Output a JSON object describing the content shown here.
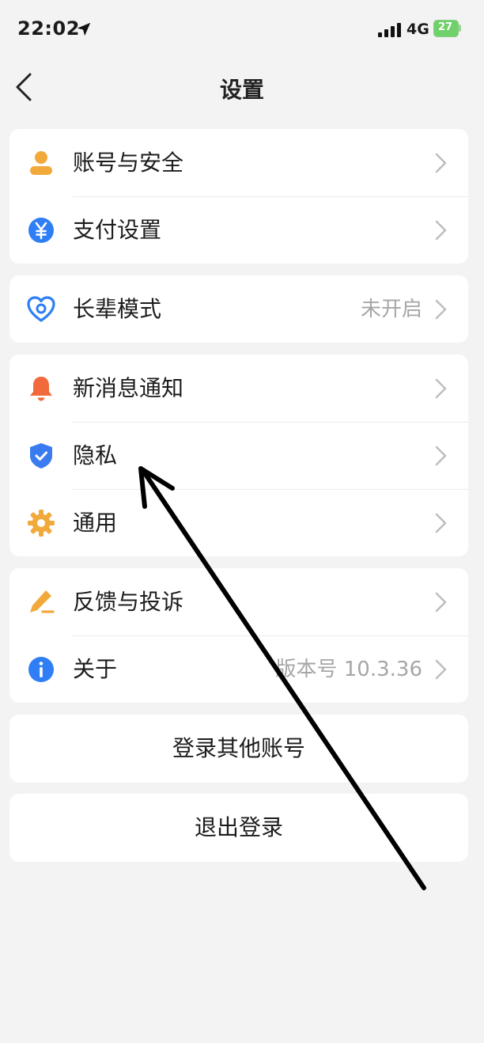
{
  "status_bar": {
    "time": "22:02",
    "network": "4G",
    "battery": "27"
  },
  "header": {
    "title": "设置"
  },
  "groups": [
    {
      "items": [
        {
          "label": "账号与安全",
          "icon": "person-icon",
          "value": ""
        },
        {
          "label": "支付设置",
          "icon": "yuan-icon",
          "value": ""
        }
      ]
    },
    {
      "items": [
        {
          "label": "长辈模式",
          "icon": "heart-icon",
          "value": "未开启"
        }
      ]
    },
    {
      "items": [
        {
          "label": "新消息通知",
          "icon": "bell-icon",
          "value": ""
        },
        {
          "label": "隐私",
          "icon": "shield-icon",
          "value": ""
        },
        {
          "label": "通用",
          "icon": "gear-icon",
          "value": ""
        }
      ]
    },
    {
      "items": [
        {
          "label": "反馈与投诉",
          "icon": "pencil-icon",
          "value": ""
        },
        {
          "label": "关于",
          "icon": "info-icon",
          "value": "版本号 10.3.36"
        }
      ]
    }
  ],
  "actions": {
    "switch_account": "登录其他账号",
    "logout": "退出登录"
  },
  "colors": {
    "background": "#f3f3f3",
    "account_icon": "#f2a93b",
    "pay_icon": "#2f7ef5",
    "elder_icon": "#2f7ef5",
    "bell_icon": "#f2693c",
    "shield_icon": "#3a7cf0",
    "gear_icon": "#f2a93b",
    "feedback_icon": "#f2a93b",
    "info_icon": "#2f7ef5",
    "annotation_arrow": "#000000"
  }
}
